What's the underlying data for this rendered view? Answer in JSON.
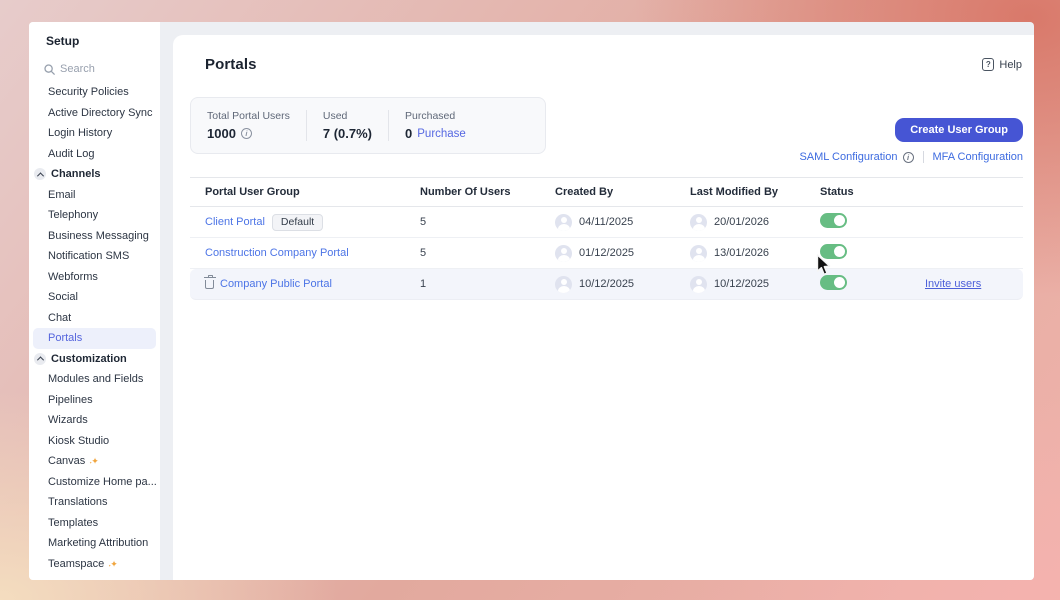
{
  "colors": {
    "accent_button": "#4655d4",
    "accent_link": "#5565dd",
    "table_link": "#4c74e6",
    "toggle_on": "#67bd83",
    "sidebar_selected_bg": "#edf0fb"
  },
  "sidebar": {
    "title": "Setup",
    "search_placeholder": "Search",
    "items": [
      {
        "label": "Security Policies",
        "type": "item"
      },
      {
        "label": "Active Directory Sync",
        "type": "item"
      },
      {
        "label": "Login History",
        "type": "item"
      },
      {
        "label": "Audit Log",
        "type": "item"
      },
      {
        "label": "Channels",
        "type": "section"
      },
      {
        "label": "Email",
        "type": "item"
      },
      {
        "label": "Telephony",
        "type": "item"
      },
      {
        "label": "Business Messaging",
        "type": "item"
      },
      {
        "label": "Notification SMS",
        "type": "item"
      },
      {
        "label": "Webforms",
        "type": "item"
      },
      {
        "label": "Social",
        "type": "item"
      },
      {
        "label": "Chat",
        "type": "item"
      },
      {
        "label": "Portals",
        "type": "item",
        "selected": true
      },
      {
        "label": "Customization",
        "type": "section"
      },
      {
        "label": "Modules and Fields",
        "type": "item"
      },
      {
        "label": "Pipelines",
        "type": "item"
      },
      {
        "label": "Wizards",
        "type": "item"
      },
      {
        "label": "Kiosk Studio",
        "type": "item"
      },
      {
        "label": "Canvas",
        "type": "item",
        "sparkle": true
      },
      {
        "label": "Customize Home pa...",
        "type": "item"
      },
      {
        "label": "Translations",
        "type": "item"
      },
      {
        "label": "Templates",
        "type": "item"
      },
      {
        "label": "Marketing Attribution",
        "type": "item"
      },
      {
        "label": "Teamspace",
        "type": "item",
        "sparkle": true
      }
    ]
  },
  "header": {
    "title": "Portals",
    "help_label": "Help"
  },
  "stats": [
    {
      "label": "Total Portal Users",
      "value": "1000",
      "has_info": true
    },
    {
      "label": "Used",
      "value": "7 (0.7%)"
    },
    {
      "label": "Purchased",
      "value": "0",
      "link": "Purchase"
    }
  ],
  "actions": {
    "create_button": "Create User Group",
    "saml_link": "SAML Configuration",
    "mfa_link": "MFA Configuration"
  },
  "table": {
    "columns": [
      "Portal User Group",
      "Number Of Users",
      "Created By",
      "Last Modified By",
      "Status"
    ],
    "rows": [
      {
        "name": "Client Portal",
        "badge": "Default",
        "users": "5",
        "created": "04/11/2025",
        "modified": "20/01/2026",
        "status": "on"
      },
      {
        "name": "Construction Company Portal",
        "users": "5",
        "created": "01/12/2025",
        "modified": "13/01/2026",
        "status": "on"
      },
      {
        "name": "Company Public Portal",
        "users": "1",
        "created": "10/12/2025",
        "modified": "10/12/2025",
        "status": "on",
        "deletable": true,
        "highlighted": true,
        "action": "Invite users"
      }
    ]
  }
}
